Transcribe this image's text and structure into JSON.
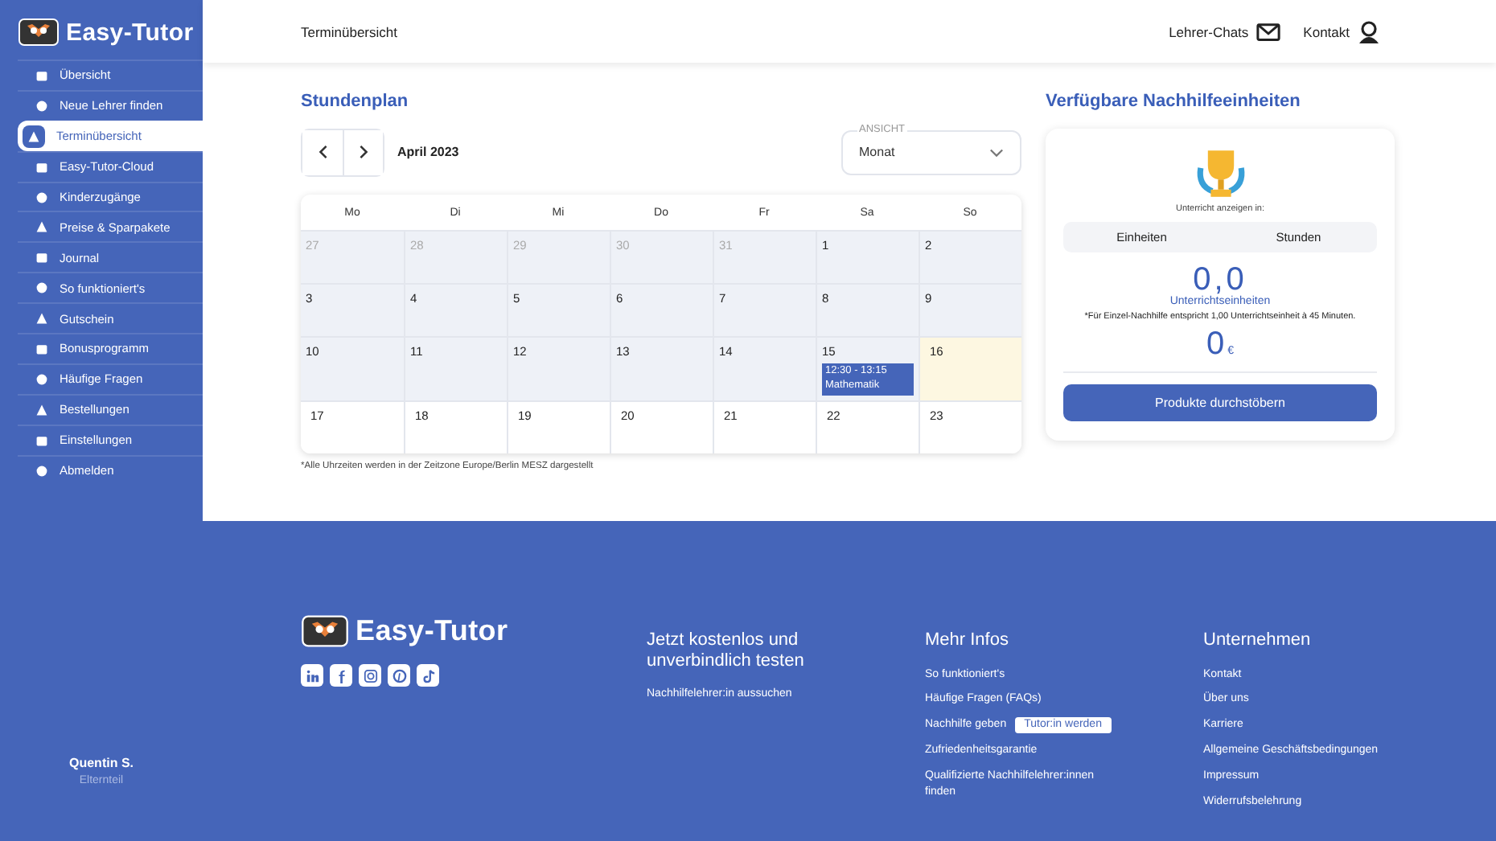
{
  "sidebar": {
    "brand": "Easy-Tutor",
    "items": [
      {
        "label": "Übersicht",
        "selected": false
      },
      {
        "label": "Neue Lehrer finden",
        "selected": false
      },
      {
        "label": "Terminübersicht",
        "selected": true
      },
      {
        "label": "Easy-Tutor-Cloud",
        "selected": false
      },
      {
        "label": "Kinderzugänge",
        "selected": false
      },
      {
        "label": "Preise & Sparpakete",
        "selected": false
      },
      {
        "label": "Journal",
        "selected": false
      },
      {
        "label": "So funktioniert's",
        "selected": false
      },
      {
        "label": "Gutschein",
        "selected": false
      },
      {
        "label": "Bonusprogramm",
        "selected": false
      },
      {
        "label": "Häufige Fragen",
        "selected": false
      },
      {
        "label": "Bestellungen",
        "selected": false
      },
      {
        "label": "Einstellungen",
        "selected": false
      },
      {
        "label": "Abmelden",
        "selected": false
      }
    ],
    "user": {
      "name": "Quentin S.",
      "role": "Elternteil"
    }
  },
  "header": {
    "title": "Terminübersicht",
    "links": [
      "Lehrer-Chats",
      "Kontakt"
    ]
  },
  "schedule": {
    "title": "Stundenplan",
    "month": "April 2023",
    "view_label": "ANSICHT",
    "view_value": "Monat",
    "weekdays": [
      "Mo",
      "Di",
      "Mi",
      "Do",
      "Fr",
      "Sa",
      "So"
    ],
    "weeks": [
      {
        "days": [
          {
            "day": "27",
            "kind": "other"
          },
          {
            "day": "28",
            "kind": "other"
          },
          {
            "day": "29",
            "kind": "other"
          },
          {
            "day": "30",
            "kind": "other"
          },
          {
            "day": "31",
            "kind": "other"
          },
          {
            "day": "1",
            "kind": "past"
          },
          {
            "day": "2",
            "kind": "past"
          }
        ]
      },
      {
        "days": [
          {
            "day": "3",
            "kind": "past"
          },
          {
            "day": "4",
            "kind": "past"
          },
          {
            "day": "5",
            "kind": "past"
          },
          {
            "day": "6",
            "kind": "past"
          },
          {
            "day": "7",
            "kind": "past"
          },
          {
            "day": "8",
            "kind": "past"
          },
          {
            "day": "9",
            "kind": "past"
          }
        ]
      },
      {
        "days": [
          {
            "day": "10",
            "kind": "past"
          },
          {
            "day": "11",
            "kind": "past"
          },
          {
            "day": "12",
            "kind": "past"
          },
          {
            "day": "13",
            "kind": "past"
          },
          {
            "day": "14",
            "kind": "past"
          },
          {
            "day": "15",
            "kind": "past",
            "events": [
              {
                "time": "12:30 - 13:15",
                "title": "Mathematik"
              }
            ]
          },
          {
            "day": "16",
            "kind": "today"
          }
        ]
      },
      {
        "days": [
          {
            "day": "17",
            "kind": "future"
          },
          {
            "day": "18",
            "kind": "future"
          },
          {
            "day": "19",
            "kind": "future"
          },
          {
            "day": "20",
            "kind": "future"
          },
          {
            "day": "21",
            "kind": "future"
          },
          {
            "day": "22",
            "kind": "future"
          },
          {
            "day": "23",
            "kind": "future"
          }
        ]
      }
    ],
    "note": "*Alle Uhrzeiten werden in der Zeitzone Europe/Berlin MESZ dargestellt"
  },
  "units": {
    "title": "Verfügbare Nachhilfeeinheiten",
    "display_label": "Unterricht anzeigen in:",
    "toggle": [
      "Einheiten",
      "Stunden"
    ],
    "amount": "0,0",
    "amount_label": "Unterrichtseinheiten",
    "footnote": "*Für Einzel-Nachhilfe entspricht 1,00 Unterrichtseinheit à 45 Minuten.",
    "money": "0",
    "currency": "€",
    "button": "Produkte durchstöbern"
  },
  "footer": {
    "brand": "Easy-Tutor",
    "try": {
      "title": "Jetzt kostenlos und unverbindlich testen",
      "links": [
        "Nachhilfelehrer:in aussuchen"
      ]
    },
    "info": {
      "title": "Mehr Infos",
      "links": [
        {
          "label": "So funktioniert's"
        },
        {
          "label": "Häufige Fragen (FAQs)"
        },
        {
          "label": "Nachhilfe geben",
          "badge": "Tutor:in werden"
        },
        {
          "label": "Zufriedenheitsgarantie"
        },
        {
          "label": "Qualifizierte Nachhilfelehrer:innen finden"
        }
      ]
    },
    "company": {
      "title": "Unternehmen",
      "links": [
        "Kontakt",
        "Über uns",
        "Karriere",
        "Allgemeine Geschäftsbedingungen",
        "Impressum",
        "Widerrufsbelehrung"
      ]
    }
  }
}
